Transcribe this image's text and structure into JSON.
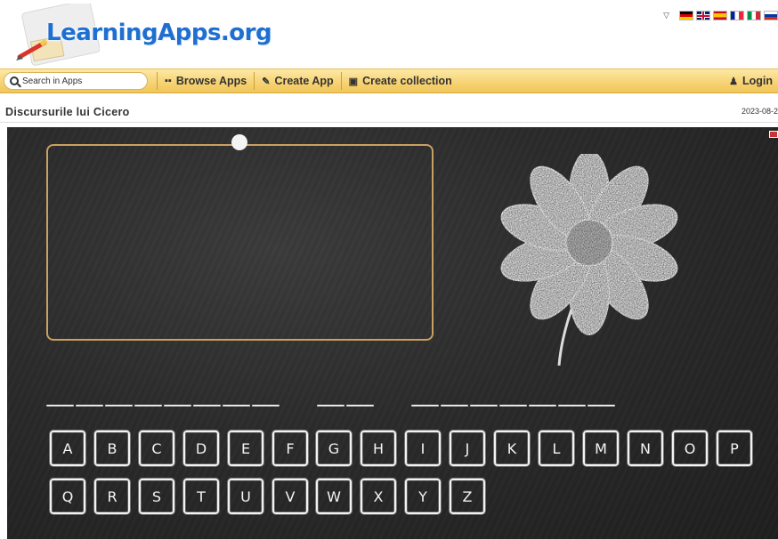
{
  "header": {
    "logo_text": "LearningApps.org",
    "languages": [
      {
        "name": "german-flag",
        "colors": [
          "#000000",
          "#dd0000",
          "#ffce00"
        ]
      },
      {
        "name": "uk-flag",
        "colors": [
          "#012169",
          "#ffffff",
          "#c8102e"
        ]
      },
      {
        "name": "spanish-flag",
        "colors": [
          "#c60b1e",
          "#ffc400",
          "#c60b1e"
        ]
      },
      {
        "name": "french-flag",
        "colors": [
          "#002395",
          "#ffffff",
          "#ed2939"
        ]
      },
      {
        "name": "italian-flag",
        "colors": [
          "#009246",
          "#ffffff",
          "#ce2b37"
        ]
      },
      {
        "name": "russian-flag",
        "colors": [
          "#ffffff",
          "#0039a6",
          "#d52b1e"
        ]
      }
    ]
  },
  "nav": {
    "search_placeholder": "Search in Apps",
    "browse_label": "Browse Apps",
    "create_label": "Create App",
    "collection_label": "Create collection",
    "login_label": "Login"
  },
  "app": {
    "title": "Discursurile lui Cicero",
    "date": "2023-08-2"
  },
  "game": {
    "word_lengths": [
      8,
      2,
      7
    ],
    "keys_row1": [
      "A",
      "B",
      "C",
      "D",
      "E",
      "F",
      "G",
      "H",
      "I",
      "J",
      "K",
      "L",
      "M",
      "N",
      "O",
      "P"
    ],
    "keys_row2": [
      "Q",
      "R",
      "S",
      "T",
      "U",
      "V",
      "W",
      "X",
      "Y",
      "Z"
    ]
  },
  "colors": {
    "nav_bg": "#f6d271",
    "logo_blue": "#1f6fd0",
    "chalkboard": "#2b2b2b",
    "frame": "#c9a062"
  }
}
